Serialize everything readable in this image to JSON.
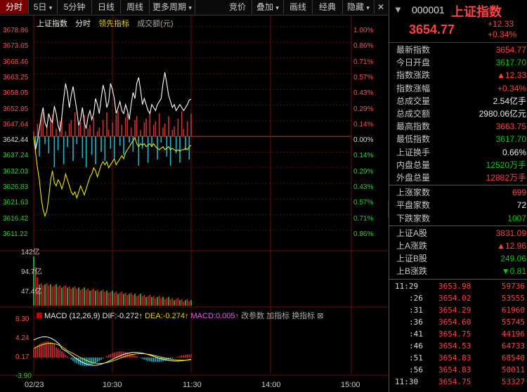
{
  "toolbar": {
    "tabs": [
      "分时",
      "5日",
      "5分钟",
      "日线",
      "周线",
      "更多周期"
    ],
    "right_tabs": [
      "竞价",
      "叠加",
      "画线",
      "经典",
      "隐藏"
    ]
  },
  "chart_legend": {
    "name": "上证指数",
    "fenshi": "分时",
    "lead": "领先指标",
    "amount": "成交额(元)"
  },
  "left_axis": [
    "3678.86",
    "3673.65",
    "3668.46",
    "3663.25",
    "3658.05",
    "3652.85",
    "3647.64",
    "3642.44",
    "3637.24",
    "3632.03",
    "3626.83",
    "3621.63",
    "3616.42",
    "3611.22"
  ],
  "right_axis": [
    "1.00%",
    "0.86%",
    "0.71%",
    "0.57%",
    "0.43%",
    "0.29%",
    "0.14%",
    "0.00%",
    "0.14%",
    "0.29%",
    "0.43%",
    "0.57%",
    "0.71%",
    "0.86%"
  ],
  "volume_axis": [
    "142亿",
    "94.7亿",
    "47.4亿"
  ],
  "macd_axis": [
    "8.30",
    "4.24",
    "0.17",
    "-3.90"
  ],
  "macd_legend": {
    "title": "MACD (12,26,9)",
    "dif": "DIF:-0.272↑",
    "dea": "DEA:-0.274↑",
    "macd": "MACD:0.005↑",
    "modify": "改参数",
    "add": "加指标",
    "switch": "换指标"
  },
  "time_axis": [
    "02/23",
    "10:30",
    "11:30",
    "14:00",
    "15:00"
  ],
  "header": {
    "code": "000001",
    "name": "上证指数",
    "price": "3654.77",
    "change": "+12.33",
    "pct": "+0.34%"
  },
  "stats": [
    {
      "label": "最新指数",
      "value": "3654.77",
      "color": "red"
    },
    {
      "label": "今日开盘",
      "value": "3617.70",
      "color": "grn"
    },
    {
      "label": "指数涨跌",
      "value": "▲12.33",
      "color": "red"
    },
    {
      "label": "指数涨幅",
      "value": "+0.34%",
      "color": "red"
    },
    {
      "label": "总成交量",
      "value": "2.54亿手",
      "color": "wht"
    },
    {
      "label": "总成交额",
      "value": "2980.06亿元",
      "color": "wht"
    },
    {
      "label": "最高指数",
      "value": "3663.75",
      "color": "red"
    },
    {
      "label": "最低指数",
      "value": "3617.70",
      "color": "grn"
    },
    {
      "label": "上证换手",
      "value": "0.66%",
      "color": "wht"
    },
    {
      "label": "内盘总量",
      "value": "12520万手",
      "color": "grn"
    },
    {
      "label": "外盘总量",
      "value": "12882万手",
      "color": "red"
    }
  ],
  "breadth": [
    {
      "label": "上涨家数",
      "value": "699",
      "color": "red"
    },
    {
      "label": "平盘家数",
      "value": "72",
      "color": "wht"
    },
    {
      "label": "下跌家数",
      "value": "1007",
      "color": "grn"
    }
  ],
  "index_b": [
    {
      "label": "上证A股",
      "value": "3831.09",
      "color": "red"
    },
    {
      "label": "上A涨跌",
      "value": "▲12.96",
      "color": "red"
    },
    {
      "label": "上证B股",
      "value": "249.06",
      "color": "grn"
    },
    {
      "label": "上B涨跌",
      "value": "▼0.81",
      "color": "grn"
    }
  ],
  "ticks": [
    {
      "time": "11:29",
      "price": "3653.98",
      "vol": "59736"
    },
    {
      "time": ":26",
      "price": "3654.02",
      "vol": "53555"
    },
    {
      "time": ":31",
      "price": "3654.29",
      "vol": "61960"
    },
    {
      "time": ":36",
      "price": "3654.60",
      "vol": "55745"
    },
    {
      "time": ":41",
      "price": "3654.75",
      "vol": "44196"
    },
    {
      "time": ":46",
      "price": "3654.53",
      "vol": "64733"
    },
    {
      "time": ":51",
      "price": "3654.83",
      "vol": "68540"
    },
    {
      "time": ":56",
      "price": "3654.83",
      "vol": "50011"
    },
    {
      "time": "11:30",
      "price": "3654.75",
      "vol": "53327"
    }
  ],
  "chart_data": {
    "type": "line",
    "title": "上证指数",
    "prev_close": 3642.44,
    "ylim": [
      3611.22,
      3678.86
    ],
    "price": [
      3642.4,
      3638.0,
      3641.0,
      3645.0,
      3649.0,
      3652.0,
      3647.0,
      3645.5,
      3650.0,
      3648.0,
      3647.0,
      3652.5,
      3650.0,
      3646.0,
      3644.0,
      3649.0,
      3655.0,
      3660.0,
      3657.0,
      3652.0,
      3656.0,
      3659.0,
      3655.0,
      3651.0,
      3646.0,
      3648.0,
      3652.0,
      3647.0,
      3645.0,
      3649.0,
      3651.0,
      3648.0,
      3650.0,
      3655.0,
      3653.0,
      3650.0,
      3655.0,
      3659.5,
      3657.0,
      3652.0,
      3654.0,
      3660.0,
      3658.0,
      3655.0,
      3650.0,
      3652.0,
      3654.0,
      3651.0,
      3650.0,
      3653.0,
      3651.0,
      3648.0,
      3653.0,
      3657.0,
      3655.0,
      3660.0,
      3662.0,
      3658.0,
      3653.0,
      3655.0,
      3653.0,
      3651.0,
      3650.0,
      3653.0,
      3652.0,
      3651.0,
      3653.0,
      3654.0,
      3655.0,
      3660.0,
      3663.7,
      3660.0,
      3656.0,
      3654.0,
      3652.0,
      3653.0,
      3651.0,
      3652.0,
      3653.0,
      3652.0,
      3651.0,
      3652.0,
      3653.0,
      3654.5,
      3654.8
    ],
    "lead": [
      3642.4,
      3637.0,
      3632.0,
      3628.0,
      3622.0,
      3618.0,
      3616.0,
      3617.7,
      3622.0,
      3628.0,
      3631.0,
      3627.0,
      3626.0,
      3628.0,
      3627.0,
      3625.0,
      3627.0,
      3630.0,
      3628.0,
      3626.0,
      3624.0,
      3623.0,
      3624.0,
      3622.0,
      3624.0,
      3626.0,
      3624.5,
      3623.0,
      3625.0,
      3627.0,
      3629.0,
      3630.0,
      3632.0,
      3631.0,
      3629.0,
      3631.0,
      3633.0,
      3634.0,
      3633.0,
      3634.0,
      3632.0,
      3633.0,
      3634.0,
      3635.0,
      3633.0,
      3634.0,
      3635.0,
      3636.0,
      3635.0,
      3637.0,
      3638.0,
      3639.0,
      3640.0,
      3641.0,
      3642.0,
      3640.0,
      3639.0,
      3640.0,
      3639.5,
      3640.0,
      3639.0,
      3639.5,
      3640.0,
      3639.0,
      3640.0,
      3639.0,
      3638.5,
      3638.0,
      3638.5,
      3639.0,
      3638.0,
      3638.5,
      3639.0,
      3638.0,
      3638.5,
      3638.0,
      3637.5,
      3638.0,
      3637.5,
      3638.0,
      3638.0,
      3638.5,
      3638.0,
      3639.0,
      3639.5
    ]
  }
}
